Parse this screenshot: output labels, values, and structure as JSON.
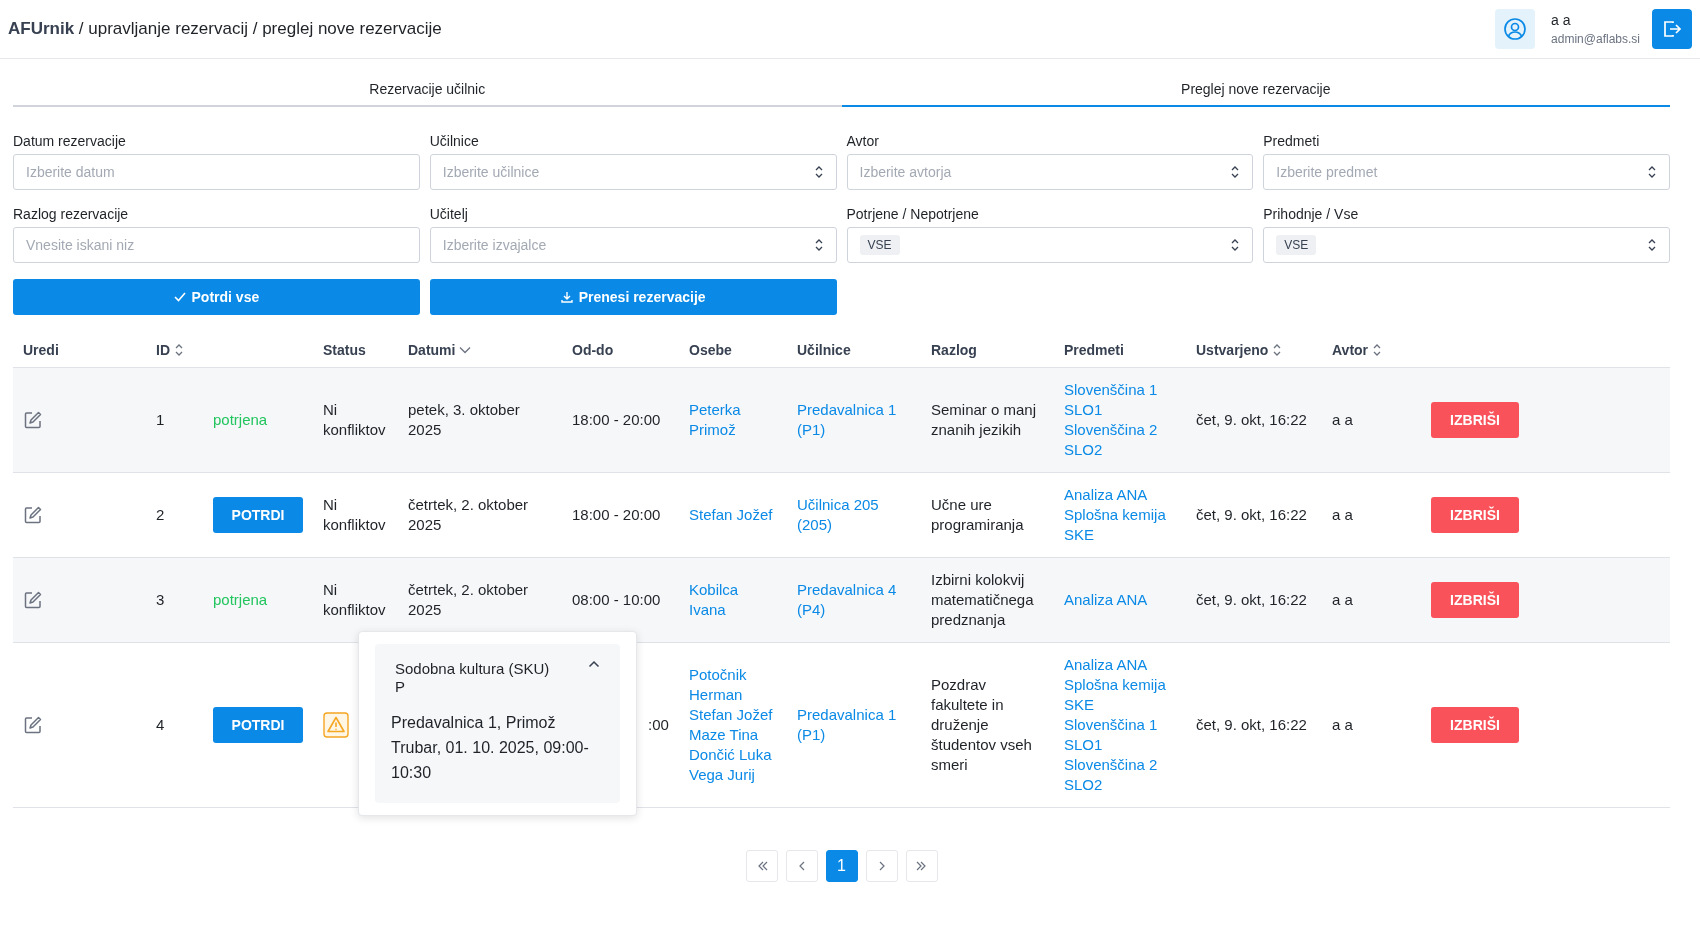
{
  "header": {
    "brand": "AFUrnik",
    "breadcrumb": " / upravljanje rezervacij / preglej nove rezervacije",
    "user_name": "a a",
    "user_email": "admin@aflabs.si"
  },
  "tabs": [
    {
      "label": "Rezervacije učilnic",
      "selected": false
    },
    {
      "label": "Preglej nove rezervacije",
      "selected": true
    }
  ],
  "filters": [
    {
      "label": "Datum rezervacije",
      "kind": "text",
      "placeholder": "Izberite datum"
    },
    {
      "label": "Učilnice",
      "kind": "select",
      "placeholder": "Izberite učilnice"
    },
    {
      "label": "Avtor",
      "kind": "select",
      "placeholder": "Izberite avtorja"
    },
    {
      "label": "Predmeti",
      "kind": "select",
      "placeholder": "Izberite predmet"
    },
    {
      "label": "Razlog rezervacije",
      "kind": "text",
      "placeholder": "Vnesite iskani niz"
    },
    {
      "label": "Učitelj",
      "kind": "select",
      "placeholder": "Izberite izvajalce"
    },
    {
      "label": "Potrjene / Nepotrjene",
      "kind": "select",
      "tag": "VSE"
    },
    {
      "label": "Prihodnje / Vse",
      "kind": "select",
      "tag": "VSE"
    }
  ],
  "actions": [
    {
      "label": "Potrdi vse",
      "kind": "confirm"
    },
    {
      "label": "Prenesi rezervacije",
      "kind": "download"
    }
  ],
  "table": {
    "columns": [
      {
        "label": "Uredi",
        "kind": "plain"
      },
      {
        "label": "ID",
        "kind": "sortable"
      },
      {
        "label": "Status",
        "kind": "plain"
      },
      {
        "label": "Datumi",
        "kind": "sorted_desc"
      },
      {
        "label": "Od-do",
        "kind": "plain"
      },
      {
        "label": "Osebe",
        "kind": "plain"
      },
      {
        "label": "Učilnice",
        "kind": "plain"
      },
      {
        "label": "Razlog",
        "kind": "plain"
      },
      {
        "label": "Predmeti",
        "kind": "plain"
      },
      {
        "label": "Ustvarjeno",
        "kind": "sortable"
      },
      {
        "label": "Avtor",
        "kind": "sortable"
      }
    ],
    "rows": [
      {
        "id": "1",
        "approval": {
          "kind": "label",
          "text": "potrjena"
        },
        "status": {
          "kind": "text",
          "text": "Ni konfliktov"
        },
        "date": "petek, 3. oktober 2025",
        "time": "18:00 - 20:00",
        "persons": [
          "Peterka Primož"
        ],
        "rooms": [
          "Predavalnica 1 (P1)"
        ],
        "reason": "Seminar o manj znanih jezikih",
        "subjects": [
          "Slovenščina 1",
          "SLO1",
          "Slovenščina 2",
          "SLO2"
        ],
        "created": "čet, 9. okt, 16:22",
        "author": "a a",
        "delete": "IZBRIŠI"
      },
      {
        "id": "2",
        "approval": {
          "kind": "button",
          "text": "POTRDI"
        },
        "status": {
          "kind": "text",
          "text": "Ni konfliktov"
        },
        "date": "četrtek, 2. oktober 2025",
        "time": "18:00 - 20:00",
        "persons": [
          "Stefan Jožef"
        ],
        "rooms": [
          "Učilnica 205 (205)"
        ],
        "reason": "Učne ure programiranja",
        "subjects": [
          "Analiza ANA",
          "Splošna kemija",
          "SKE"
        ],
        "created": "čet, 9. okt, 16:22",
        "author": "a a",
        "delete": "IZBRIŠI"
      },
      {
        "id": "3",
        "approval": {
          "kind": "label",
          "text": "potrjena"
        },
        "status": {
          "kind": "text",
          "text": "Ni konfliktov"
        },
        "date": "četrtek, 2. oktober 2025",
        "time": "08:00 - 10:00",
        "persons": [
          "Kobilca Ivana"
        ],
        "rooms": [
          "Predavalnica 4 (P4)"
        ],
        "reason": "Izbirni kolokvij matematičnega predznanja",
        "subjects": [
          "Analiza ANA"
        ],
        "created": "čet, 9. okt, 16:22",
        "author": "a a",
        "delete": "IZBRIŠI"
      },
      {
        "id": "4",
        "approval": {
          "kind": "button",
          "text": "POTRDI"
        },
        "status": {
          "kind": "warning"
        },
        "time": ":00",
        "persons": [
          "Potočnik Herman",
          "Stefan Jožef",
          "Maze Tina",
          "Dončić Luka",
          "Vega Jurij"
        ],
        "rooms": [
          "Predavalnica 1 (P1)"
        ],
        "reason": "Pozdrav fakultete in druženje študentov vseh smeri",
        "subjects": [
          "Analiza ANA",
          "Splošna kemija",
          "SKE",
          "Slovenščina 1",
          "SLO1",
          "Slovenščina 2",
          "SLO2"
        ],
        "created": "čet, 9. okt, 16:22",
        "author": "a a",
        "delete": "IZBRIŠI",
        "popup": {
          "title": "Sodobna kultura (SKU) P",
          "expanded": true,
          "body": "Predavalnica 1, Primož Trubar, 01. 10. 2025, 09:00-10:30"
        }
      }
    ]
  },
  "pagination": [
    {
      "kind": "first",
      "selected": false
    },
    {
      "kind": "prev",
      "selected": false
    },
    {
      "kind": "page",
      "label": "1",
      "selected": true
    },
    {
      "kind": "next",
      "selected": false
    },
    {
      "kind": "last",
      "selected": false
    }
  ]
}
